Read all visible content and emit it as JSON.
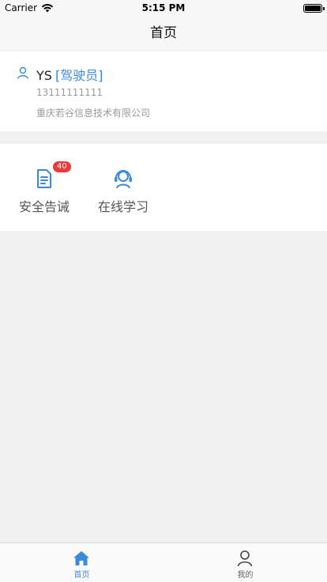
{
  "status_bar": {
    "carrier": "Carrier",
    "time": "5:15 PM"
  },
  "nav": {
    "title": "首页"
  },
  "profile": {
    "name": "YS",
    "role": "[驾驶员]",
    "phone": "13111111111",
    "company": "重庆若谷信息技术有限公司"
  },
  "functions": [
    {
      "label": "安全告诫",
      "badge": "40",
      "icon": "document-icon"
    },
    {
      "label": "在线学习",
      "icon": "headset-user-icon"
    }
  ],
  "tabs": [
    {
      "label": "首页",
      "icon": "home-icon",
      "active": true
    },
    {
      "label": "我的",
      "icon": "user-icon",
      "active": false
    }
  ],
  "colors": {
    "accent": "#3b8ad9",
    "badge": "#ea3b3b",
    "background": "#f0f0f0"
  }
}
